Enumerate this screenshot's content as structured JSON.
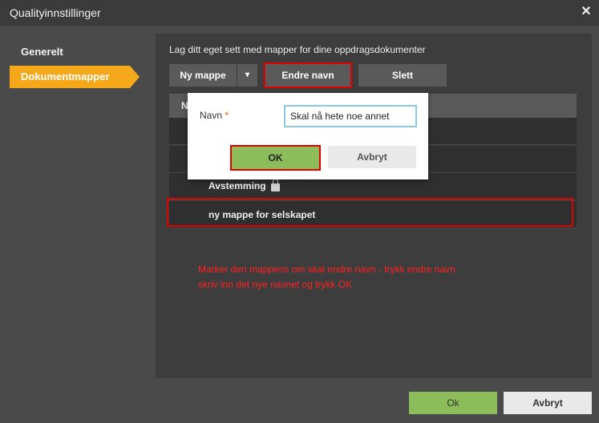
{
  "window": {
    "title": "Qualityinnstillinger",
    "close_glyph": "✕"
  },
  "sidebar": {
    "items": [
      {
        "label": "Generelt"
      },
      {
        "label": "Dokumentmapper"
      }
    ]
  },
  "main": {
    "description": "Lag ditt eget sett med mapper for dine oppdragsdokumenter",
    "toolbar": {
      "new_folder": "Ny mappe",
      "dropdown_glyph": "▾",
      "rename": "Endre navn",
      "delete": "Slett"
    },
    "table": {
      "header": "N",
      "rows": [
        {
          "label": "",
          "locked": false
        },
        {
          "label": "",
          "locked": false
        },
        {
          "label": "Avstemming",
          "locked": true
        },
        {
          "label": "ny mappe for selskapet",
          "locked": false
        }
      ]
    }
  },
  "popup": {
    "name_label": "Navn",
    "required_mark": "*",
    "name_value": "Skal nå hete noe annet",
    "ok": "OK",
    "cancel": "Avbryt"
  },
  "annotation": {
    "line1": "Marker den mappens om skal endre navn - trykk endre navn",
    "line2": "skriv inn det nye navnet og trykk OK",
    "color": "#ff2020"
  },
  "footer": {
    "ok": "Ok",
    "cancel": "Avbryt"
  },
  "colors": {
    "accent": "#f6a81b",
    "ok_green": "#8dbd5a",
    "highlight_red": "#e00000"
  }
}
